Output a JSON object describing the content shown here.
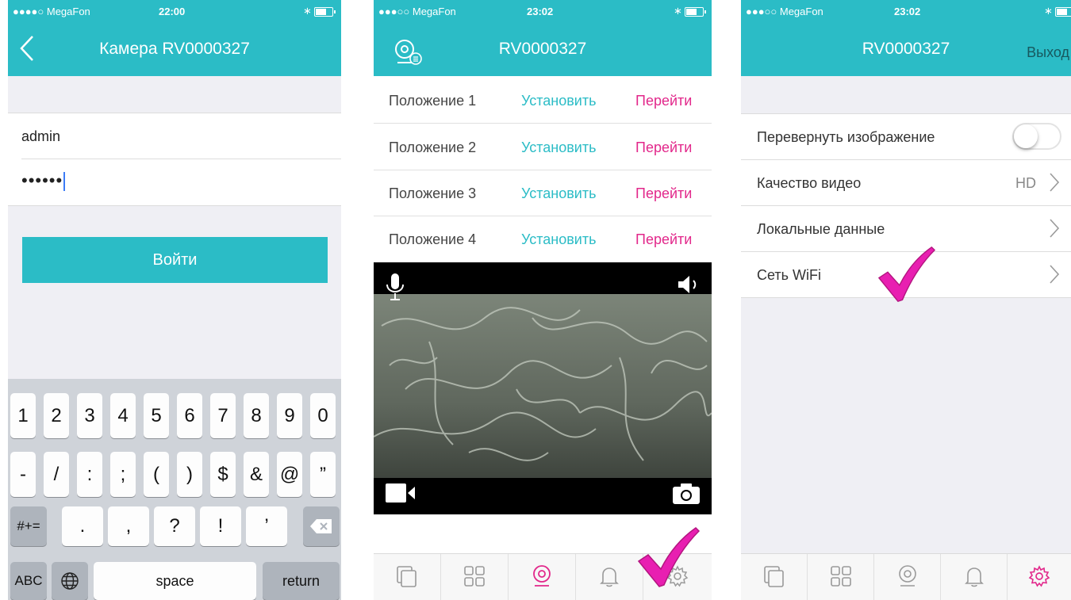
{
  "colors": {
    "accent": "#2bbcc6",
    "pink": "#e2288b",
    "check": "#e81fb1"
  },
  "phone1": {
    "status": {
      "carrier": "●●●●○ MegaFon",
      "time": "22:00"
    },
    "nav": {
      "title": "Камера RV0000327",
      "back_icon": "chevron-left-icon"
    },
    "username": "admin",
    "password": "••••••",
    "login_label": "Войти",
    "keyboard": {
      "row1": [
        "1",
        "2",
        "3",
        "4",
        "5",
        "6",
        "7",
        "8",
        "9",
        "0"
      ],
      "row2": [
        "-",
        "/",
        ":",
        ";",
        "(",
        ")",
        "$",
        "&",
        "@",
        "”"
      ],
      "row3_mode": "#+=",
      "row3": [
        ".",
        ",",
        "?",
        "!",
        "’"
      ],
      "row4_abc": "ABC",
      "row4_space": "space",
      "row4_return": "return"
    }
  },
  "phone2": {
    "status": {
      "carrier": "●●●○○ MegaFon",
      "time": "23:02"
    },
    "nav": {
      "title": "RV0000327"
    },
    "presets": [
      {
        "label": "Положение 1",
        "set": "Установить",
        "go": "Перейти"
      },
      {
        "label": "Положение 2",
        "set": "Установить",
        "go": "Перейти"
      },
      {
        "label": "Положение 3",
        "set": "Установить",
        "go": "Перейти"
      },
      {
        "label": "Положение 4",
        "set": "Установить",
        "go": "Перейти"
      }
    ]
  },
  "phone3": {
    "status": {
      "carrier": "●●●○○ MegaFon",
      "time": "23:02"
    },
    "nav": {
      "title": "RV0000327",
      "exit_label": "Выход"
    },
    "settings": [
      {
        "label": "Перевернуть изображение",
        "toggle": false
      },
      {
        "label": "Качество видео",
        "value": "HD"
      },
      {
        "label": "Локальные данные"
      },
      {
        "label": "Сеть WiFi"
      }
    ]
  },
  "tabbar": {
    "icons": [
      "pages-icon",
      "grid-icon",
      "camera-icon",
      "bell-icon",
      "gear-icon"
    ]
  }
}
